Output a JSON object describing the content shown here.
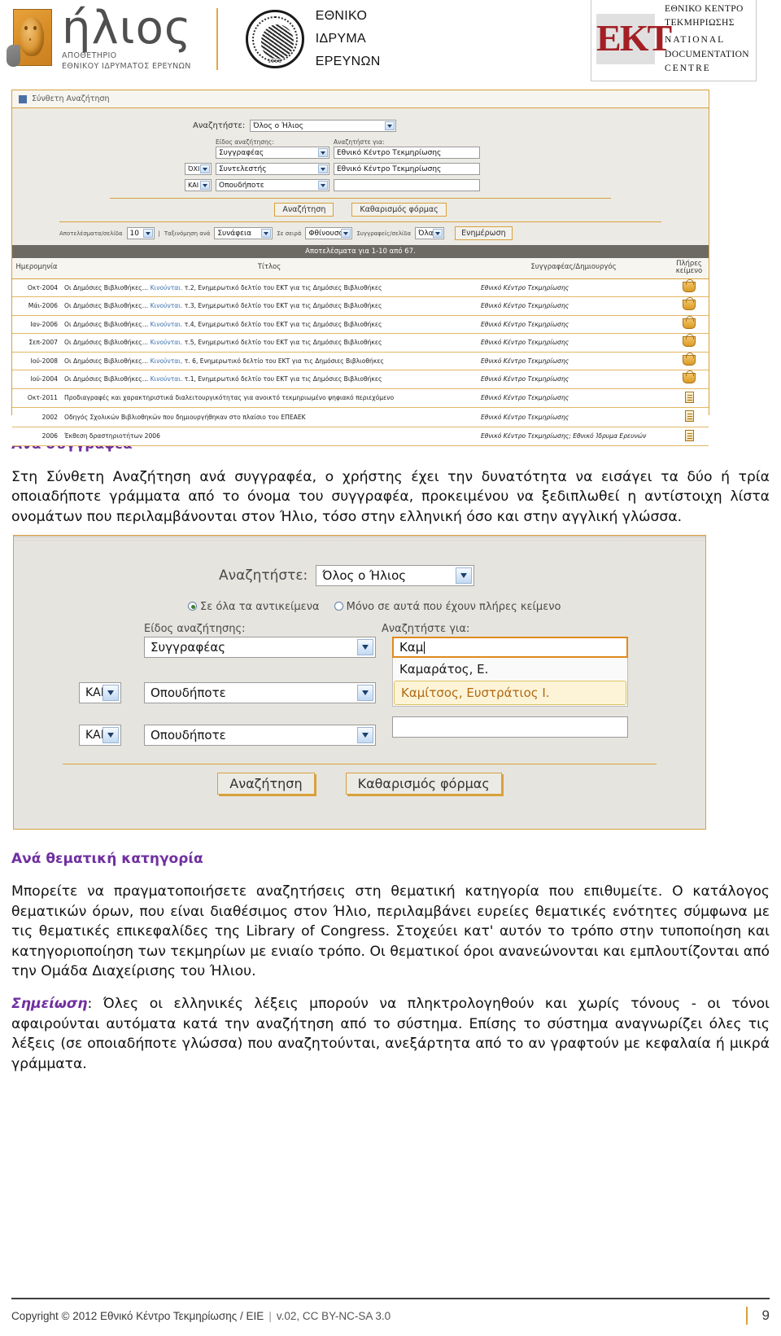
{
  "header": {
    "ilios_word": "ήλιος",
    "ilios_sub_line1": "ΑΠΟΘΕΤΗΡΙΟ",
    "ilios_sub_line2": "ΕΘΝΙΚΟΥ ΙΔΡΥΜΑΤΟΣ ΕΡΕΥΝΩΝ",
    "eie_line1": "ΕΘΝΙΚΟ",
    "eie_line2": "ΙΔΡΥΜΑ",
    "eie_line3": "ΕΡΕΥΝΩΝ",
    "eie_seal_year": "1958",
    "ekt_mark": "EKT",
    "ekt_line1": "ΕΘΝΙΚΟ ΚΕΝΤΡΟ",
    "ekt_line2": "ΤΕΚΜΗΡΙΩΣΗΣ",
    "ekt_line3": "NATIONAL",
    "ekt_line4": "DOCUMENTATION",
    "ekt_line5": "CENTRE",
    "accent_orange": "#d8a13c",
    "accent_purple": "#7030a0",
    "ekt_red": "#a31f24"
  },
  "screenshot1": {
    "window_title": "Σύνθετη Αναζήτηση",
    "search_in_label": "Αναζητήστε:",
    "search_in_value": "Όλος ο Ήλιος",
    "col_label_type": "Είδος αναζήτησης:",
    "col_label_for": "Αναζητήστε για:",
    "rows": [
      {
        "bool": "",
        "type": "Συγγραφέας",
        "value": "Εθνικό Κέντρο Τεκμηρίωσης"
      },
      {
        "bool": "ΌΧΙ",
        "type": "Συντελεστής",
        "value": "Εθνικό Κέντρο Τεκμηρίωσης"
      },
      {
        "bool": "ΚΑΙ",
        "type": "Οπουδήποτε",
        "value": ""
      }
    ],
    "btn_search": "Αναζήτηση",
    "btn_clear": "Καθαρισμός φόρμας",
    "opt_perpage_label": "Αποτελέσματα/σελίδα",
    "opt_perpage_value": "10",
    "opt_divider": "|",
    "opt_sortby_label": "Ταξινόμηση ανά",
    "opt_sortby_value": "Συνάφεια",
    "opt_order_label": "Σε σειρά",
    "opt_order_value": "Φθίνουσα",
    "opt_authors_label": "Συγγραφείς/σελίδα",
    "opt_authors_value": "Όλα",
    "btn_update": "Ενημέρωση",
    "results_bar": "Αποτελέσματα για 1-10 από 67.",
    "columns": [
      "Ημερομηνία",
      "Τίτλος",
      "Συγγραφέας/Δημιουργός",
      "Πλήρες κείμενο"
    ],
    "table_rows": [
      {
        "date": "Οκτ-2004",
        "title_a": "Οι Δημόσιες Βιβλιοθήκες… ",
        "title_kw": "Κινούνται.",
        "title_b": " τ.2, Ενημερωτικό δελτίο του ΕΚΤ για τις Δημόσιες Βιβλιοθήκες",
        "author": "Εθνικό Κέντρο Τεκμηρίωσης",
        "ft": "basket-icon"
      },
      {
        "date": "Μάι-2006",
        "title_a": "Οι Δημόσιες Βιβλιοθήκες… ",
        "title_kw": "Κινούνται.",
        "title_b": " τ.3, Ενημερωτικό δελτίο του ΕΚΤ για τις Δημόσιες Βιβλιοθήκες",
        "author": "Εθνικό Κέντρο Τεκμηρίωσης",
        "ft": "basket-icon"
      },
      {
        "date": "Ιαν-2006",
        "title_a": "Οι Δημόσιες Βιβλιοθήκες… ",
        "title_kw": "Κινούνται.",
        "title_b": " τ.4, Ενημερωτικό δελτίο του ΕΚΤ για τις Δημόσιες Βιβλιοθήκες",
        "author": "Εθνικό Κέντρο Τεκμηρίωσης",
        "ft": "basket-icon"
      },
      {
        "date": "Σεπ-2007",
        "title_a": "Οι Δημόσιες Βιβλιοθήκες… ",
        "title_kw": "Κινούνται.",
        "title_b": " τ.5, Ενημερωτικό δελτίο του ΕΚΤ για τις Δημόσιες Βιβλιοθήκες",
        "author": "Εθνικό Κέντρο Τεκμηρίωσης",
        "ft": "basket-icon"
      },
      {
        "date": "Ιού-2008",
        "title_a": "Οι Δημόσιες Βιβλιοθήκες… ",
        "title_kw": "Κινούνται,",
        "title_b": " τ. 6, Ενημερωτικό δελτίο του ΕΚΤ για τις Δημόσιες Βιβλιοθήκες",
        "author": "Εθνικό Κέντρο Τεκμηρίωσης",
        "ft": "basket-icon"
      },
      {
        "date": "Ιού-2004",
        "title_a": "Οι Δημόσιες Βιβλιοθήκες… ",
        "title_kw": "Κινούνται.",
        "title_b": " τ.1, Ενημερωτικό δελτίο του ΕΚΤ για τις Δημόσιες Βιβλιοθήκες",
        "author": "Εθνικό Κέντρο Τεκμηρίωσης",
        "ft": "basket-icon"
      },
      {
        "date": "Οκτ-2011",
        "title_a": "Προδιαγραφές και χαρακτηριστικά διαλειτουργικότητας για ανοικτό τεκμηριωμένο ψηφιακό περιεχόμενο",
        "title_kw": "",
        "title_b": "",
        "author": "Εθνικό Κέντρο Τεκμηρίωσης",
        "ft": "doc-icon"
      },
      {
        "date": "2002",
        "title_a": "Οδηγός Σχολικών Βιβλιοθηκών που δημιουργήθηκαν στο πλαίσιο του ΕΠΕΑΕΚ",
        "title_kw": "",
        "title_b": "",
        "author": "Εθνικό Κέντρο Τεκμηρίωσης",
        "ft": "doc-icon"
      },
      {
        "date": "2006",
        "title_a": "Έκθεση δραστηριοτήτων 2006",
        "title_kw": "",
        "title_b": "",
        "author": "Εθνικό Κέντρο Τεκμηρίωσης; Εθνικό Ίδρυμα Ερευνών",
        "ft": "doc-icon"
      }
    ]
  },
  "section_author": {
    "heading": "Ανά συγγραφέα",
    "paragraph": "Στη Σύνθετη Αναζήτηση ανά συγγραφέα, ο χρήστης έχει την δυνατότητα να εισάγει τα δύο ή τρία οποιαδήποτε γράμματα από το όνομα του συγγραφέα, προκειμένου να ξεδιπλωθεί η αντίστοιχη λίστα ονομάτων που περιλαμβάνονται στον Ήλιο, τόσο στην ελληνική όσο και στην αγγλική γλώσσα."
  },
  "screenshot2": {
    "search_in_label": "Αναζητήστε:",
    "search_in_value": "Όλος ο Ήλιος",
    "radio_all_label": "Σε όλα τα αντικείμενα",
    "radio_fulltext_label": "Μόνο σε αυτά που έχουν πλήρες κείμενο",
    "col_label_type": "Είδος αναζήτησης:",
    "col_label_for": "Αναζητήστε για:",
    "row1_type": "Συγγραφέας",
    "row1_value": "Καμ",
    "row2_bool": "ΚΑΙ",
    "row2_type": "Οπουδήποτε",
    "row2_value": "",
    "row3_bool": "ΚΑΙ",
    "row3_type": "Οπουδήποτε",
    "row3_value": "",
    "autocomplete": [
      "Καμαράτος, Ε.",
      "Καμίτσος, Ευστράτιος Ι."
    ],
    "autocomplete_selected_index": 1,
    "btn_search": "Αναζήτηση",
    "btn_clear": "Καθαρισμός φόρμας"
  },
  "section_subject": {
    "heading": "Ανά θεματική κατηγορία",
    "paragraph": "Μπορείτε να πραγματοποιήσετε αναζητήσεις   στη θεματική κατηγορία που επιθυμείτε. Ο κατάλογος θεματικών όρων, που είναι διαθέσιμος στον Ήλιο, περιλαμβάνει ευρείες θεματικές ενότητες σύμφωνα με τις θεματικές επικεφαλίδες της Library of Congress. Στοχεύει κατ' αυτόν το τρόπο στην τυποποίηση και κατηγοριοποίηση των τεκμηρίων με ενιαίο τρόπο. Οι θεματικοί όροι ανανεώνονται και εμπλουτίζονται από την Ομάδα Διαχείρισης του Ήλιου.",
    "note_label": "Σημείωση",
    "note_text": ": Όλες οι ελληνικές λέξεις μπορούν να πληκτρολογηθούν και χωρίς τόνους - οι τόνοι αφαιρούνται αυτόματα κατά την αναζήτηση από το σύστημα. Επίσης το σύστημα αναγνωρίζει όλες τις λέξεις (σε οποιαδήποτε γλώσσα) που αναζητούνται, ανεξάρτητα από το αν γραφτούν με κεφαλαία ή μικρά γράμματα."
  },
  "footer": {
    "copyright": "Copyright © 2012 Εθνικό Κέντρο Τεκμηρίωσης / ΕΙΕ",
    "separator": "|",
    "version": "v.02,  CC BY-NC-SA 3.0",
    "page": "9"
  }
}
